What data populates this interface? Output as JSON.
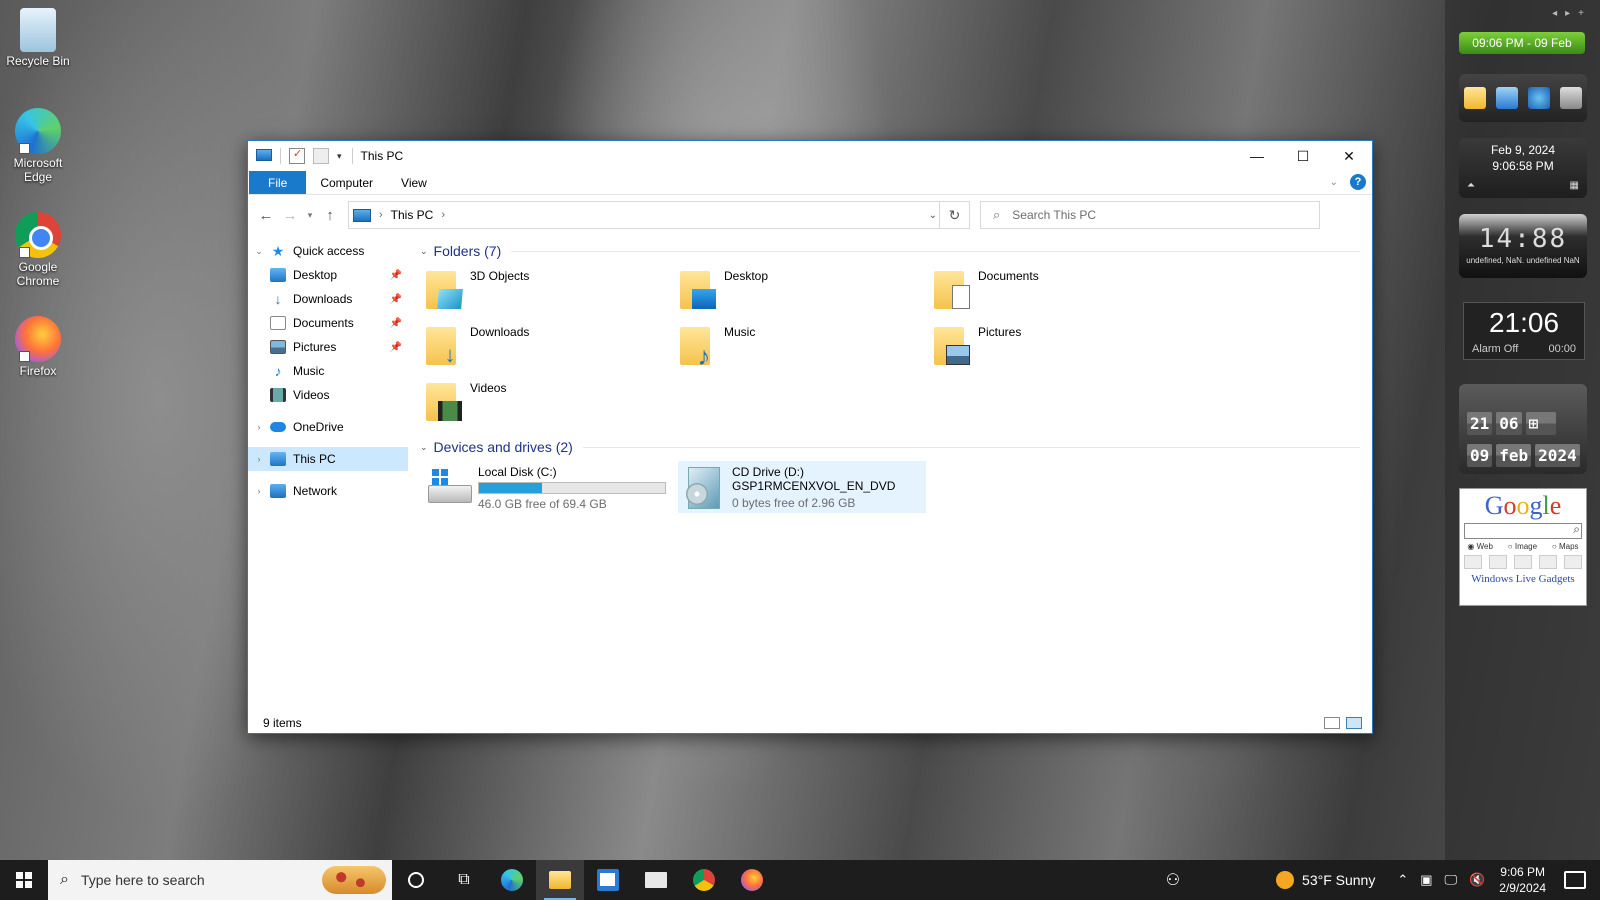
{
  "desktop": {
    "icons": [
      {
        "label": "Recycle Bin",
        "icon": "recycle-bin-icon"
      },
      {
        "label": "Microsoft Edge",
        "icon": "edge-icon"
      },
      {
        "label": "Google Chrome",
        "icon": "chrome-icon"
      },
      {
        "label": "Firefox",
        "icon": "firefox-icon"
      }
    ]
  },
  "window": {
    "title": "This PC",
    "controls": {
      "minimize": "—",
      "maximize": "☐",
      "close": "✕"
    },
    "ribbon": {
      "tabs": [
        "File",
        "Computer",
        "View"
      ],
      "help": "?"
    },
    "address": {
      "path": "This PC",
      "search_placeholder": "Search This PC"
    },
    "nav": {
      "quick_access": "Quick access",
      "pinned": [
        "Desktop",
        "Downloads",
        "Documents",
        "Pictures"
      ],
      "unpinned": [
        "Music",
        "Videos"
      ],
      "onedrive": "OneDrive",
      "this_pc": "This PC",
      "network": "Network"
    },
    "folders_header": "Folders (7)",
    "folders": [
      "3D Objects",
      "Desktop",
      "Documents",
      "Downloads",
      "Music",
      "Pictures",
      "Videos"
    ],
    "devices_header": "Devices and drives (2)",
    "drives": [
      {
        "name": "Local Disk (C:)",
        "free": "46.0 GB free of 69.4 GB",
        "used_fraction": 0.337
      },
      {
        "name": "CD Drive (D:)",
        "label": "GSP1RMCENXVOL_EN_DVD",
        "free": "0 bytes free of 2.96 GB"
      }
    ],
    "status": "9 items"
  },
  "gadgets": {
    "clock_bar": "09:06 PM - 09 Feb",
    "date_line": "Feb 9, 2024",
    "time_line": "9:06:58 PM",
    "digital_big": "14:88",
    "digital_small": "undefined, NaN. undefined NaN",
    "alarm_time": "21:06",
    "alarm_label": "Alarm Off",
    "alarm_right": "00:00",
    "flip": {
      "hour": "21",
      "minute": "06",
      "day": "09",
      "month": "feb",
      "year": "2024"
    },
    "google": {
      "radios": [
        "Web",
        "Image",
        "Maps"
      ],
      "footer": "Windows Live Gadgets"
    }
  },
  "taskbar": {
    "search_placeholder": "Type here to search",
    "weather": "53°F  Sunny",
    "time": "9:06 PM",
    "date": "2/9/2024"
  }
}
